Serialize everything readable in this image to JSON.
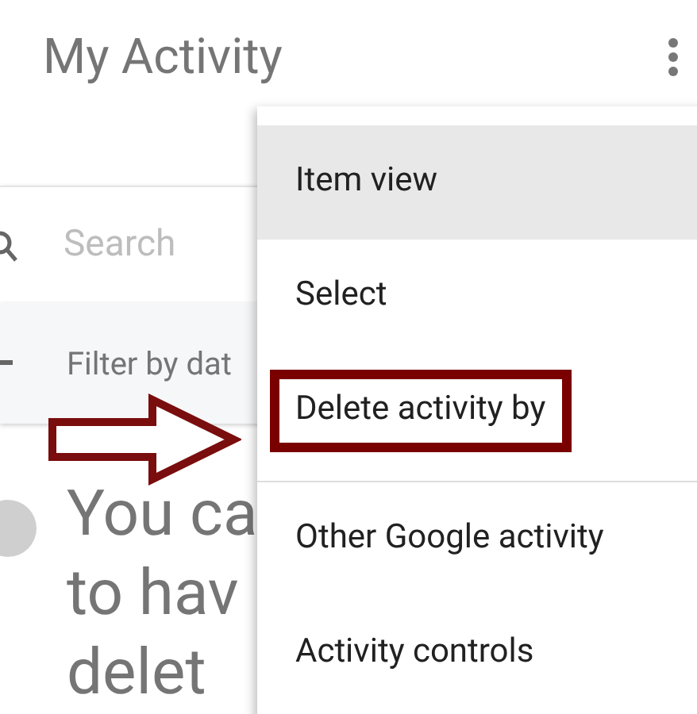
{
  "header": {
    "title": "My Activity"
  },
  "search": {
    "placeholder": "Search"
  },
  "filter": {
    "label": "Filter by dat"
  },
  "message": {
    "lines": [
      "You ca",
      "to hav",
      "delet"
    ]
  },
  "menu": {
    "items": [
      {
        "label": "Item view",
        "selected": true,
        "highlighted": false,
        "divider_before": false
      },
      {
        "label": "Select",
        "selected": false,
        "highlighted": false,
        "divider_before": false
      },
      {
        "label": "Delete activity by",
        "selected": false,
        "highlighted": true,
        "divider_before": false
      },
      {
        "label": "Other Google activity",
        "selected": false,
        "highlighted": false,
        "divider_before": true
      },
      {
        "label": "Activity controls",
        "selected": false,
        "highlighted": false,
        "divider_before": false
      }
    ]
  }
}
